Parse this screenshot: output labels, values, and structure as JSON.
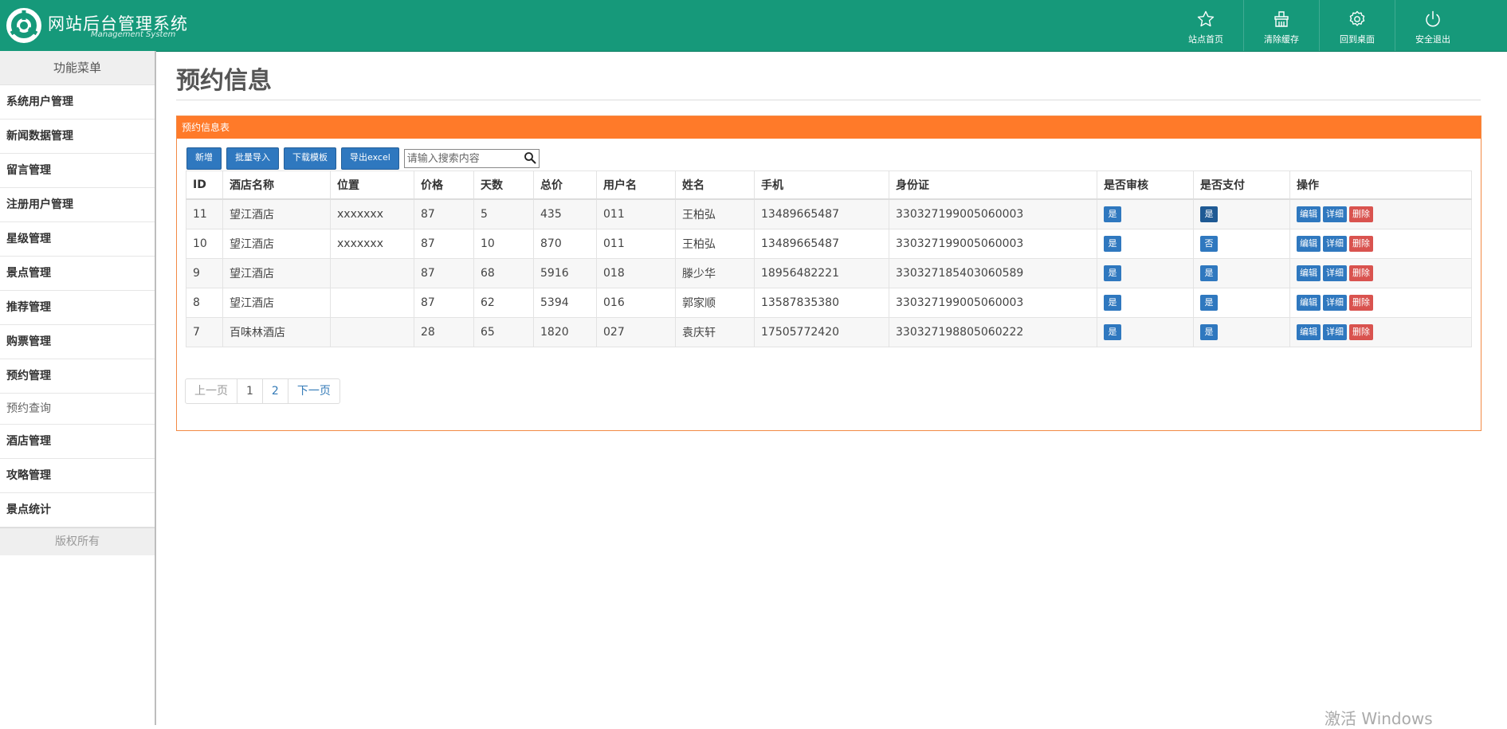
{
  "header": {
    "title": "网站后台管理系统",
    "subtitle": "Management System",
    "actions": [
      {
        "label": "站点首页",
        "icon": "star-icon"
      },
      {
        "label": "清除缓存",
        "icon": "broom-icon"
      },
      {
        "label": "回到桌面",
        "icon": "gear-icon"
      },
      {
        "label": "安全退出",
        "icon": "power-icon"
      }
    ]
  },
  "sidebar": {
    "heading": "功能菜单",
    "items": [
      "系统用户管理",
      "新闻数据管理",
      "留言管理",
      "注册用户管理",
      "星级管理",
      "景点管理",
      "推荐管理",
      "购票管理",
      "预约管理"
    ],
    "sub_item": "预约查询",
    "items_after": [
      "酒店管理",
      "攻略管理",
      "景点统计"
    ],
    "footer": "版权所有"
  },
  "page": {
    "title": "预约信息",
    "panel_title": "预约信息表"
  },
  "toolbar": {
    "add": "新增",
    "batch_import": "批量导入",
    "download_template": "下载模板",
    "export_excel": "导出excel",
    "search_placeholder": "请输入搜索内容"
  },
  "table": {
    "columns": [
      "ID",
      "酒店名称",
      "位置",
      "价格",
      "天数",
      "总价",
      "用户名",
      "姓名",
      "手机",
      "身份证",
      "是否审核",
      "是否支付",
      "操作"
    ],
    "actions": {
      "edit": "编辑",
      "detail": "详细",
      "delete": "删除"
    },
    "rows": [
      {
        "id": "11",
        "hotel": "望江酒店",
        "location": "xxxxxxx",
        "price": "87",
        "days": "5",
        "total": "435",
        "username": "011",
        "name": "王柏弘",
        "phone": "13489665487",
        "idcard": "330327199005060003",
        "audited": "是",
        "paid": "是"
      },
      {
        "id": "10",
        "hotel": "望江酒店",
        "location": "xxxxxxx",
        "price": "87",
        "days": "10",
        "total": "870",
        "username": "011",
        "name": "王柏弘",
        "phone": "13489665487",
        "idcard": "330327199005060003",
        "audited": "是",
        "paid": "否"
      },
      {
        "id": "9",
        "hotel": "望江酒店",
        "location": "",
        "price": "87",
        "days": "68",
        "total": "5916",
        "username": "018",
        "name": "滕少华",
        "phone": "18956482221",
        "idcard": "330327185403060589",
        "audited": "是",
        "paid": "是"
      },
      {
        "id": "8",
        "hotel": "望江酒店",
        "location": "",
        "price": "87",
        "days": "62",
        "total": "5394",
        "username": "016",
        "name": "郭家顺",
        "phone": "13587835380",
        "idcard": "330327199005060003",
        "audited": "是",
        "paid": "是"
      },
      {
        "id": "7",
        "hotel": "百味林酒店",
        "location": "",
        "price": "28",
        "days": "65",
        "total": "1820",
        "username": "027",
        "name": "袁庆轩",
        "phone": "17505772420",
        "idcard": "330327198805060222",
        "audited": "是",
        "paid": "是"
      }
    ]
  },
  "pagination": {
    "prev": "上一页",
    "pages": [
      "1",
      "2"
    ],
    "next": "下一页"
  },
  "watermark": "激活 Windows",
  "colors": {
    "header_bg": "#16997a",
    "panel_head": "#ff7a29",
    "button_blue": "#2f78bf",
    "button_red": "#d9534f"
  }
}
